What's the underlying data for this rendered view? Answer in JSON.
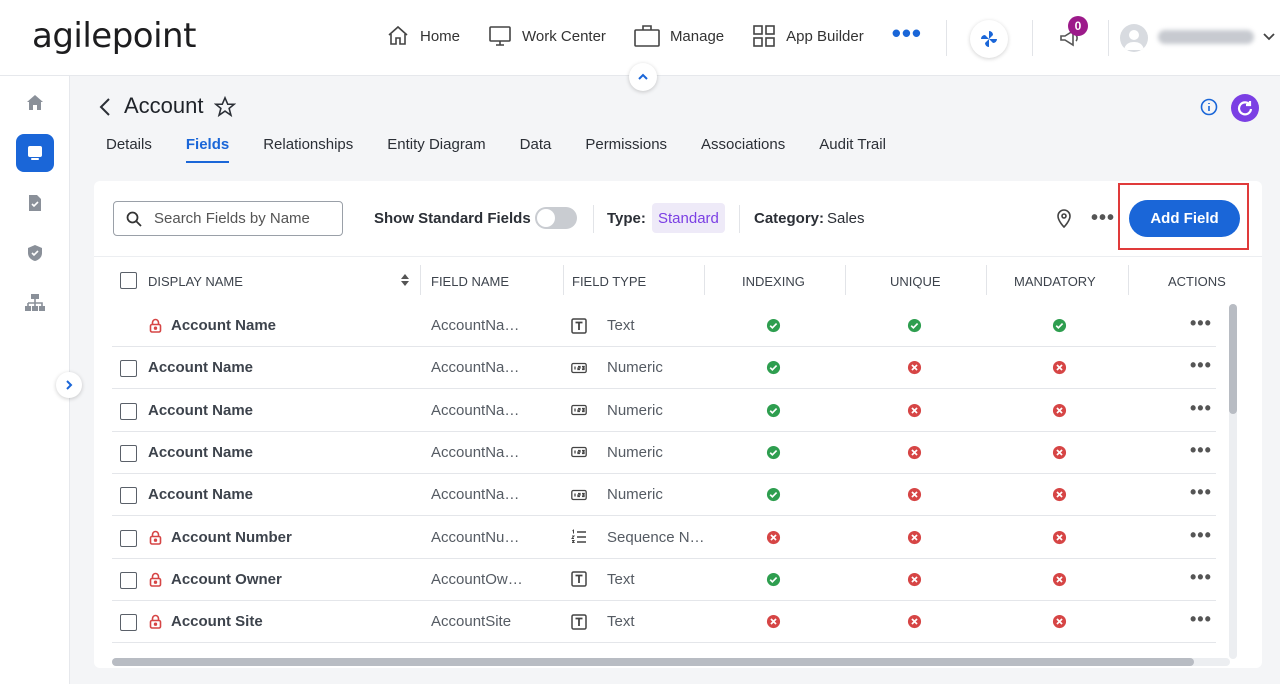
{
  "header": {
    "logo": "agilepoint",
    "nav": [
      {
        "label": "Home",
        "icon": "home-icon"
      },
      {
        "label": "Work Center",
        "icon": "monitor-icon"
      },
      {
        "label": "Manage",
        "icon": "briefcase-icon"
      },
      {
        "label": "App Builder",
        "icon": "grid-icon"
      }
    ],
    "more": "•••",
    "notification_count": "0",
    "accent": "#1a66d8"
  },
  "page": {
    "title": "Account",
    "tabs": [
      "Details",
      "Fields",
      "Relationships",
      "Entity Diagram",
      "Data",
      "Permissions",
      "Associations",
      "Audit Trail"
    ],
    "active_tab": "Fields"
  },
  "toolbar": {
    "search_placeholder": "Search Fields by Name",
    "show_standard_label": "Show Standard Fields",
    "show_standard_on": false,
    "type_label": "Type:",
    "type_value": "Standard",
    "category_label": "Category:",
    "category_value": "Sales",
    "add_label": "Add Field"
  },
  "table": {
    "columns": [
      "DISPLAY NAME",
      "FIELD NAME",
      "FIELD TYPE",
      "INDEXING",
      "UNIQUE",
      "MANDATORY",
      "ACTIONS"
    ],
    "rows": [
      {
        "display": "Account Name",
        "field": "AccountNa…",
        "type": "Text",
        "type_icon": "text-icon",
        "locked": true,
        "checkbox": false,
        "indexing": true,
        "unique": true,
        "mandatory": true
      },
      {
        "display": "Account Name",
        "field": "AccountNa…",
        "type": "Numeric",
        "type_icon": "numeric-icon",
        "locked": false,
        "checkbox": true,
        "indexing": true,
        "unique": false,
        "mandatory": false
      },
      {
        "display": "Account Name",
        "field": "AccountNa…",
        "type": "Numeric",
        "type_icon": "numeric-icon",
        "locked": false,
        "checkbox": true,
        "indexing": true,
        "unique": false,
        "mandatory": false
      },
      {
        "display": "Account Name",
        "field": "AccountNa…",
        "type": "Numeric",
        "type_icon": "numeric-icon",
        "locked": false,
        "checkbox": true,
        "indexing": true,
        "unique": false,
        "mandatory": false
      },
      {
        "display": "Account Name",
        "field": "AccountNa…",
        "type": "Numeric",
        "type_icon": "numeric-icon",
        "locked": false,
        "checkbox": true,
        "indexing": true,
        "unique": false,
        "mandatory": false
      },
      {
        "display": "Account Number",
        "field": "AccountNu…",
        "type": "Sequence N…",
        "type_icon": "sequence-icon",
        "locked": true,
        "checkbox": true,
        "indexing": false,
        "unique": false,
        "mandatory": false
      },
      {
        "display": "Account Owner",
        "field": "AccountOw…",
        "type": "Text",
        "type_icon": "text-icon",
        "locked": true,
        "checkbox": true,
        "indexing": true,
        "unique": false,
        "mandatory": false
      },
      {
        "display": "Account Site",
        "field": "AccountSite",
        "type": "Text",
        "type_icon": "text-icon",
        "locked": true,
        "checkbox": true,
        "indexing": false,
        "unique": false,
        "mandatory": false
      }
    ],
    "colors": {
      "yes": "#2e9e4f",
      "no": "#d64545",
      "lock": "#d64545"
    }
  }
}
